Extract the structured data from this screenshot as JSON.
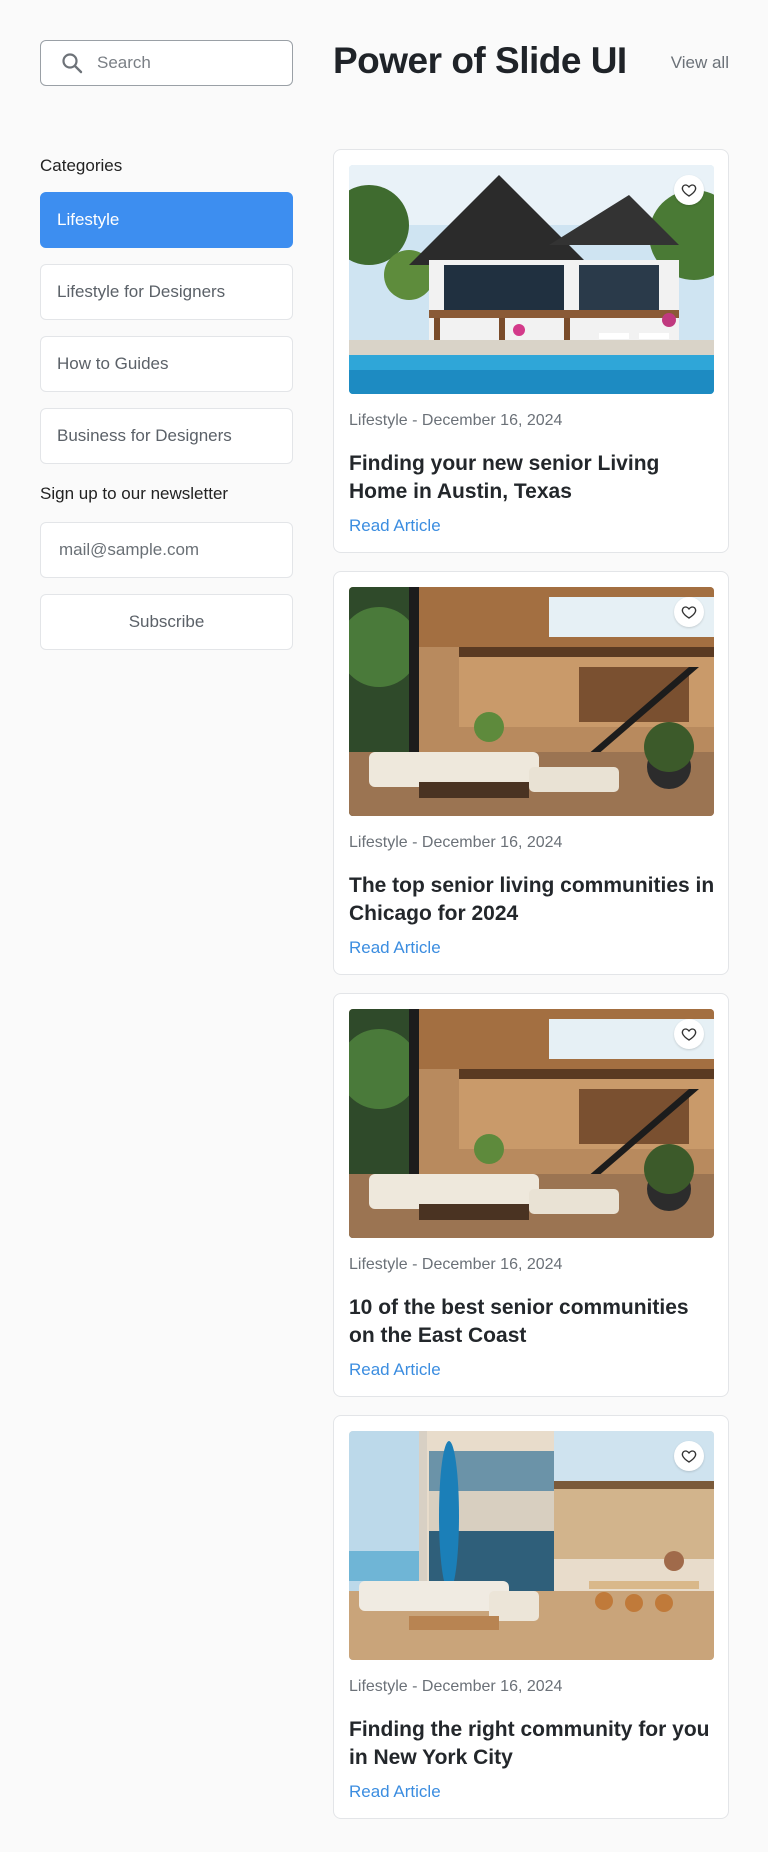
{
  "search": {
    "placeholder": "Search"
  },
  "sidebar": {
    "categories_label": "Categories",
    "categories": [
      {
        "label": "Lifestyle",
        "active": true
      },
      {
        "label": "Lifestyle for Designers",
        "active": false
      },
      {
        "label": "How to Guides",
        "active": false
      },
      {
        "label": "Business for Designers",
        "active": false
      }
    ],
    "newsletter_label": "Sign up to our newsletter",
    "email_placeholder": "mail@sample.com",
    "subscribe_label": "Subscribe"
  },
  "main": {
    "title": "Power of Slide UI",
    "view_all": "View all",
    "articles": [
      {
        "meta": "Lifestyle - December 16, 2024",
        "title": "Finding your new senior Living Home in Austin, Texas",
        "link": "Read Article",
        "image": "modern-house-with-pool"
      },
      {
        "meta": "Lifestyle - December 16, 2024",
        "title": "The top senior living communities in Chicago for 2024",
        "link": "Read Article",
        "image": "modern-living-room-interior"
      },
      {
        "meta": "Lifestyle - December 16, 2024",
        "title": "10 of the best senior communities on the East Coast",
        "link": "Read Article",
        "image": "modern-living-room-interior"
      },
      {
        "meta": "Lifestyle - December 16, 2024",
        "title": "Finding the right community for you in New York City",
        "link": "Read Article",
        "image": "beach-house-living-room"
      }
    ]
  },
  "colors": {
    "accent": "#3d8ef0",
    "link": "#3b8de0",
    "border": "#e3e5e8"
  }
}
